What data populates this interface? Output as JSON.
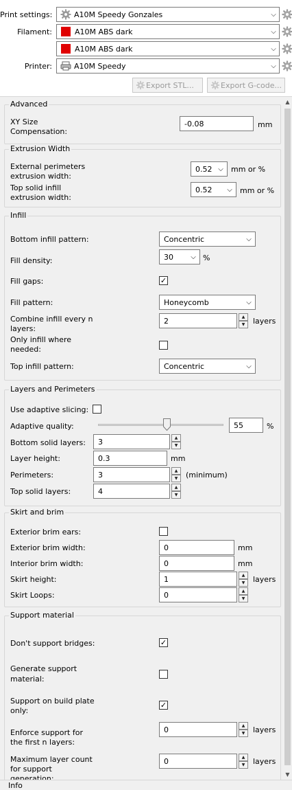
{
  "top": {
    "print_settings_label": "Print settings:",
    "print_settings_value": "A10M Speedy Gonzales",
    "filament_label": "Filament:",
    "filament_1": "A10M ABS dark",
    "filament_2": "A10M ABS dark",
    "filament_color": "#e00000",
    "printer_label": "Printer:",
    "printer_value": "A10M Speedy",
    "export_stl": "Export STL...",
    "export_gcode": "Export G-code..."
  },
  "advanced": {
    "title": "Advanced",
    "xy_label_1": "XY Size",
    "xy_label_2": "Compensation:",
    "xy_value": "-0.08",
    "xy_unit": "mm"
  },
  "extrusion": {
    "title": "Extrusion Width",
    "ext_label_1": "External perimeters",
    "ext_label_2": "extrusion width:",
    "ext_value": "0.52",
    "ext_unit": "mm or %",
    "top_label_1": "Top solid infill",
    "top_label_2": "extrusion width:",
    "top_value": "0.52",
    "top_unit": "mm or %"
  },
  "infill": {
    "title": "Infill",
    "bottom_pattern_label": "Bottom infill pattern:",
    "bottom_pattern_value": "Concentric",
    "density_label": "Fill density:",
    "density_value": "30",
    "density_unit": "%",
    "gaps_label": "Fill gaps:",
    "gaps_checked": "✓",
    "fill_pattern_label": "Fill pattern:",
    "fill_pattern_value": "Honeycomb",
    "combine_label_1": "Combine infill every n",
    "combine_label_2": "layers:",
    "combine_value": "2",
    "combine_unit": "layers",
    "only_where_label_1": "Only infill where",
    "only_where_label_2": "needed:",
    "top_pattern_label": "Top infill pattern:",
    "top_pattern_value": "Concentric"
  },
  "layers": {
    "title": "Layers and Perimeters",
    "adaptive_label": "Use adaptive slicing:",
    "quality_label": "Adaptive quality:",
    "quality_value": "55",
    "quality_fraction": 0.55,
    "quality_unit": "%",
    "bottom_solid_label": "Bottom solid layers:",
    "bottom_solid_value": "3",
    "layer_height_label": "Layer height:",
    "layer_height_value": "0.3",
    "layer_height_unit": "mm",
    "perimeters_label": "Perimeters:",
    "perimeters_value": "3",
    "perimeters_unit": "(minimum)",
    "top_solid_label": "Top solid layers:",
    "top_solid_value": "4"
  },
  "skirt": {
    "title": "Skirt and brim",
    "ears_label": "Exterior brim ears:",
    "ext_brim_label": "Exterior brim width:",
    "ext_brim_value": "0",
    "ext_brim_unit": "mm",
    "int_brim_label": "Interior brim width:",
    "int_brim_value": "0",
    "int_brim_unit": "mm",
    "skirt_height_label": "Skirt height:",
    "skirt_height_value": "1",
    "skirt_height_unit": "layers",
    "skirt_loops_label": "Skirt Loops:",
    "skirt_loops_value": "0"
  },
  "support": {
    "title": "Support material",
    "bridges_label": "Don't support bridges:",
    "bridges_checked": "✓",
    "generate_label_1": "Generate support",
    "generate_label_2": "material:",
    "buildplate_label_1": "Support on build plate",
    "buildplate_label_2": "only:",
    "buildplate_checked": "✓",
    "enforce_label_1": "Enforce support for",
    "enforce_label_2": "the first n layers:",
    "enforce_value": "0",
    "enforce_unit": "layers",
    "maxlayer_label_1": "Maximum layer count",
    "maxlayer_label_2": "for support",
    "maxlayer_label_3": "generation:",
    "maxlayer_value": "0",
    "maxlayer_unit": "layers"
  },
  "info": {
    "title": "Info"
  }
}
